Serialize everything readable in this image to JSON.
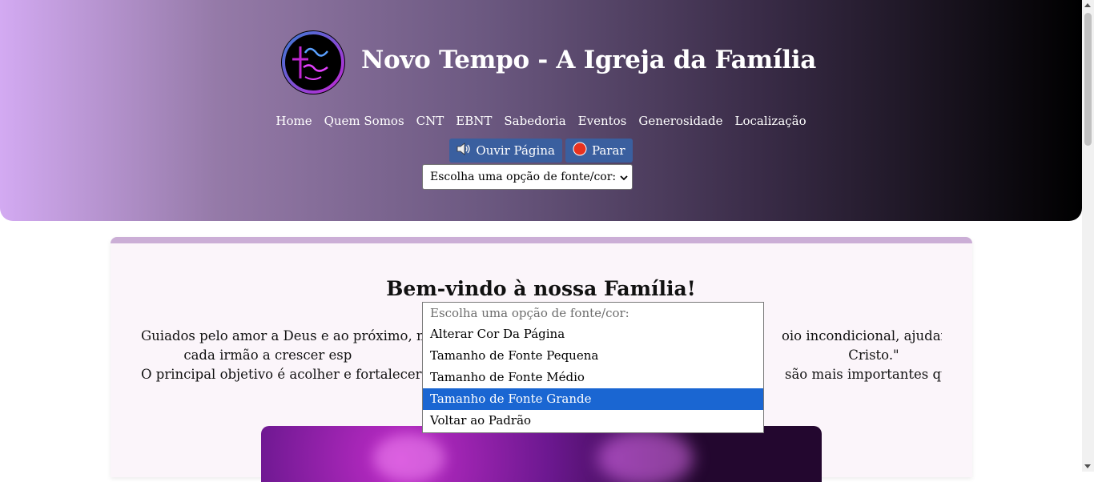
{
  "header": {
    "site_title": "Novo Tempo - A Igreja da Família",
    "logo_text": "Novo Tempo",
    "nav": [
      "Home",
      "Quem Somos",
      "CNT",
      "EBNT",
      "Sabedoria",
      "Eventos",
      "Generosidade",
      "Localização"
    ],
    "listen_button": "Ouvir Página",
    "stop_button": "Parar",
    "font_select": "Escolha uma opção de fonte/cor:"
  },
  "main": {
    "welcome_title": "Bem-vindo à nossa Família!",
    "para_line1_left": "Guiados pelo amor a Deus e ao próximo, nos",
    "para_line1_right": "oio incondicional, ajudando",
    "para_line2_left": "cada irmão a crescer esp",
    "para_line2_right": "Cristo.\"",
    "para_line3_left": "O principal objetivo é acolher e fortalecer es",
    "para_line3_right": "são mais importantes que"
  },
  "dropdown": {
    "options": [
      "Escolha uma opção de fonte/cor:",
      "Alterar Cor Da Página",
      "Tamanho de Fonte Pequena",
      "Tamanho de Fonte Médio",
      "Tamanho de Fonte Grande",
      "Voltar ao Padrão"
    ],
    "highlighted_index": 4
  },
  "colors": {
    "button_bg": "#3a5f9f",
    "highlight": "#1a66d2",
    "card_border": "#cbaed6"
  }
}
